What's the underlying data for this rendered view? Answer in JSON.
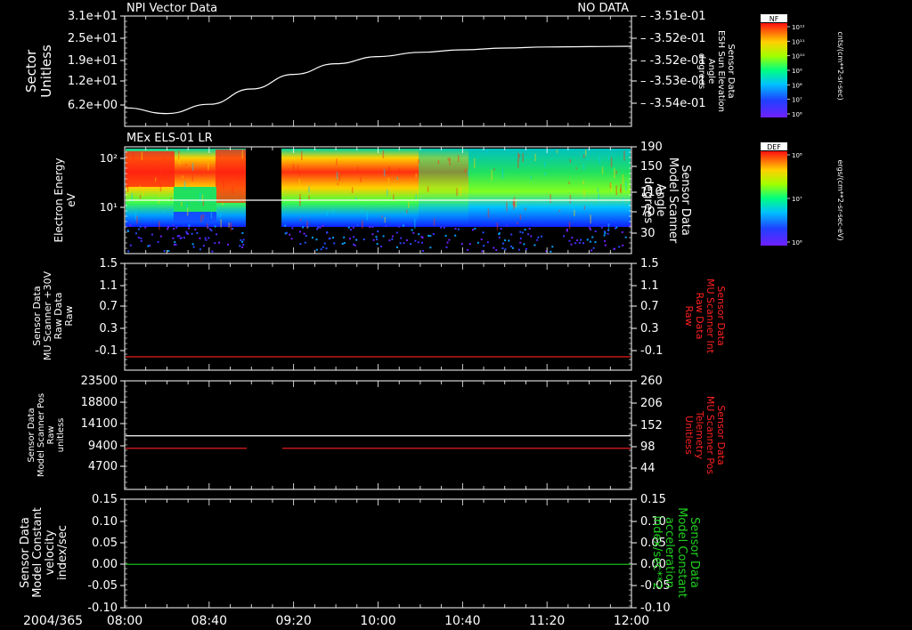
{
  "colors": {
    "background": "#000000",
    "axis": "#ffffff",
    "red_trace": "#ff2020",
    "green_trace": "#20d020"
  },
  "time_axis": {
    "date": "2004/365",
    "ticks": [
      "08:00",
      "08:40",
      "09:20",
      "10:00",
      "10:40",
      "11:20",
      "12:00"
    ]
  },
  "panels": [
    {
      "id": "p1",
      "title": "NPI Vector Data",
      "status": "NO DATA",
      "left_label": [
        "Sector",
        "Unitless"
      ],
      "right_label": [
        "Sensor Data",
        "ESH Sun Elevation",
        "Angle",
        "degrees"
      ],
      "left_ticks": [
        "3.1e+01",
        "2.5e+01",
        "1.9e+01",
        "1.2e+01",
        "6.2e+00"
      ],
      "right_ticks": [
        "-3.51e-01",
        "-3.52e-01",
        "-3.52e-01",
        "-3.53e-01",
        "-3.54e-01"
      ],
      "colorbar": {
        "title": "NF",
        "ticks": [
          "10¹²",
          "10¹¹",
          "10¹⁰",
          "10⁹",
          "10⁸",
          "10⁷",
          "10⁶"
        ],
        "unit": "cnts/(cm**2-sr-sec)"
      }
    },
    {
      "id": "p2",
      "title": "MEx ELS-01 LR",
      "left_label": [
        "Electron Energy",
        "eV"
      ],
      "right_label": [
        "Sensor Data",
        "Model Scanner",
        "Angle",
        "degrees"
      ],
      "left_ticks": [
        "10²",
        "10¹"
      ],
      "right_ticks": [
        "190",
        "150",
        "110",
        "70",
        "30"
      ],
      "colorbar": {
        "title": "DEF",
        "ticks": [
          "10⁸",
          "10⁷",
          "10⁶"
        ],
        "unit": "ergs/(cm**2-sr-sec-eV)"
      }
    },
    {
      "id": "p3",
      "left_label": [
        "Sensor Data",
        "MU Scanner +30V",
        "Raw Data",
        "Raw"
      ],
      "right_label": [
        "Sensor Data",
        "MU Scanner Int",
        "Raw Data",
        "Raw"
      ],
      "left_ticks": [
        "1.5",
        "1.1",
        "0.7",
        "0.3",
        "-0.1"
      ],
      "right_ticks": [
        "1.5",
        "1.1",
        "0.7",
        "0.3",
        "-0.1"
      ]
    },
    {
      "id": "p4",
      "left_label": [
        "Sensor Data",
        "Model Scanner Pos",
        "Raw",
        "unitless"
      ],
      "right_label": [
        "Sensor Data",
        "MU Scanner Pos",
        "Telemetry",
        "Unitless"
      ],
      "left_ticks": [
        "23500",
        "18800",
        "14100",
        "9400",
        "4700"
      ],
      "right_ticks": [
        "260",
        "206",
        "152",
        "98",
        "44"
      ]
    },
    {
      "id": "p5",
      "left_label": [
        "Sensor Data",
        "Model Constant",
        "velocity",
        "index/sec"
      ],
      "right_label": [
        "Sensor Data",
        "Model Constant",
        "acceleration",
        "index/sec**2"
      ],
      "left_ticks": [
        "0.15",
        "0.10",
        "0.05",
        "0.00",
        "-0.05",
        "-0.10"
      ],
      "right_ticks": [
        "0.15",
        "0.10",
        "0.05",
        "0.00",
        "-0.05",
        "-0.10"
      ]
    }
  ],
  "chart_data": [
    {
      "type": "line",
      "title": "NPI Vector Data",
      "x": [
        "08:00",
        "08:20",
        "08:40",
        "09:00",
        "09:20",
        "09:40",
        "10:00",
        "10:20",
        "10:40",
        "11:00",
        "11:20",
        "11:40",
        "12:00"
      ],
      "series": [
        {
          "values": [
            5.2,
            3.6,
            6.2,
            10.5,
            14.6,
            17.6,
            19.6,
            20.8,
            21.5,
            22.0,
            22.3,
            22.4,
            22.5
          ]
        }
      ],
      "ylim": [
        0,
        31
      ]
    },
    {
      "type": "heatmap",
      "title": "MEx ELS-01 LR",
      "x_range": [
        "08:00",
        "12:00"
      ],
      "data_gap": [
        "08:53",
        "09:12"
      ],
      "ylim_eV": [
        2,
        190
      ],
      "overlay_line": {
        "values": [
          90
        ],
        "axis": "right"
      }
    },
    {
      "type": "line",
      "series": [
        {
          "values": [
            -0.03
          ],
          "color": "#ff2020"
        }
      ],
      "ylim": [
        -0.25,
        1.5
      ]
    },
    {
      "type": "line",
      "series": [
        {
          "values": [
            11600
          ],
          "color": "#ffffff"
        },
        {
          "values": [
            8900
          ],
          "color": "#ff2020",
          "gap": [
            "08:53",
            "09:12"
          ]
        }
      ],
      "ylim": [
        0,
        23500
      ]
    },
    {
      "type": "line",
      "series": [
        {
          "values": [
            0.0
          ],
          "color": "#20d020"
        }
      ],
      "ylim": [
        -0.1,
        0.15
      ]
    }
  ]
}
